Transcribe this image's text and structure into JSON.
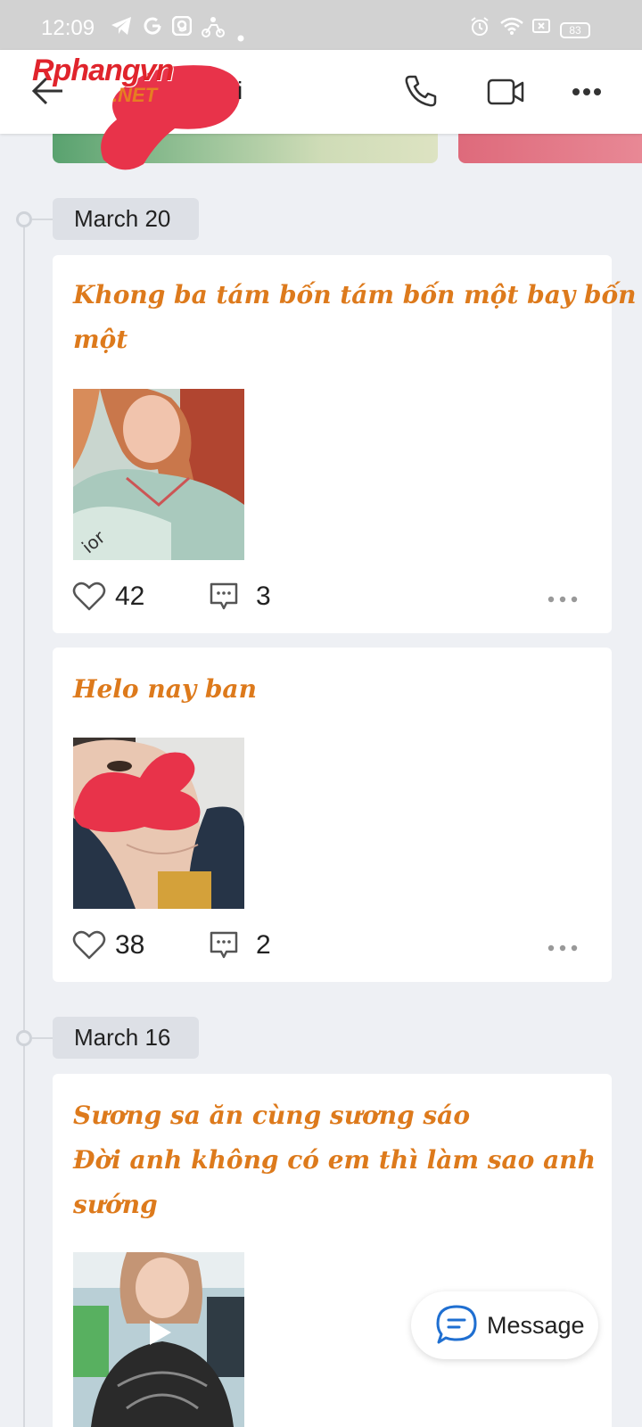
{
  "status_bar": {
    "time": "12:09",
    "battery": "83"
  },
  "header": {
    "logo_main": "Rphangvn",
    "logo_sub": ".NET",
    "name_visible": "i"
  },
  "timeline": [
    {
      "date": "March 20",
      "posts": [
        {
          "caption_lines": [
            "Khong ba tám bốn tám bốn một bay bốn",
            "một"
          ],
          "likes": "42",
          "comments": "3"
        },
        {
          "caption_lines": [
            "Helo nay ban"
          ],
          "likes": "38",
          "comments": "2"
        }
      ]
    },
    {
      "date": "March 16",
      "posts": [
        {
          "caption_lines": [
            "Sương sa ăn cùng sương sáo",
            "Đời anh không có em thì làm sao anh",
            "sướng"
          ]
        }
      ]
    }
  ],
  "message_button": {
    "label": "Message"
  },
  "colors": {
    "caption": "#dd7a1c",
    "background": "#eef0f4",
    "accent_blue": "#1f6fd1",
    "redaction": "#e8334a"
  }
}
